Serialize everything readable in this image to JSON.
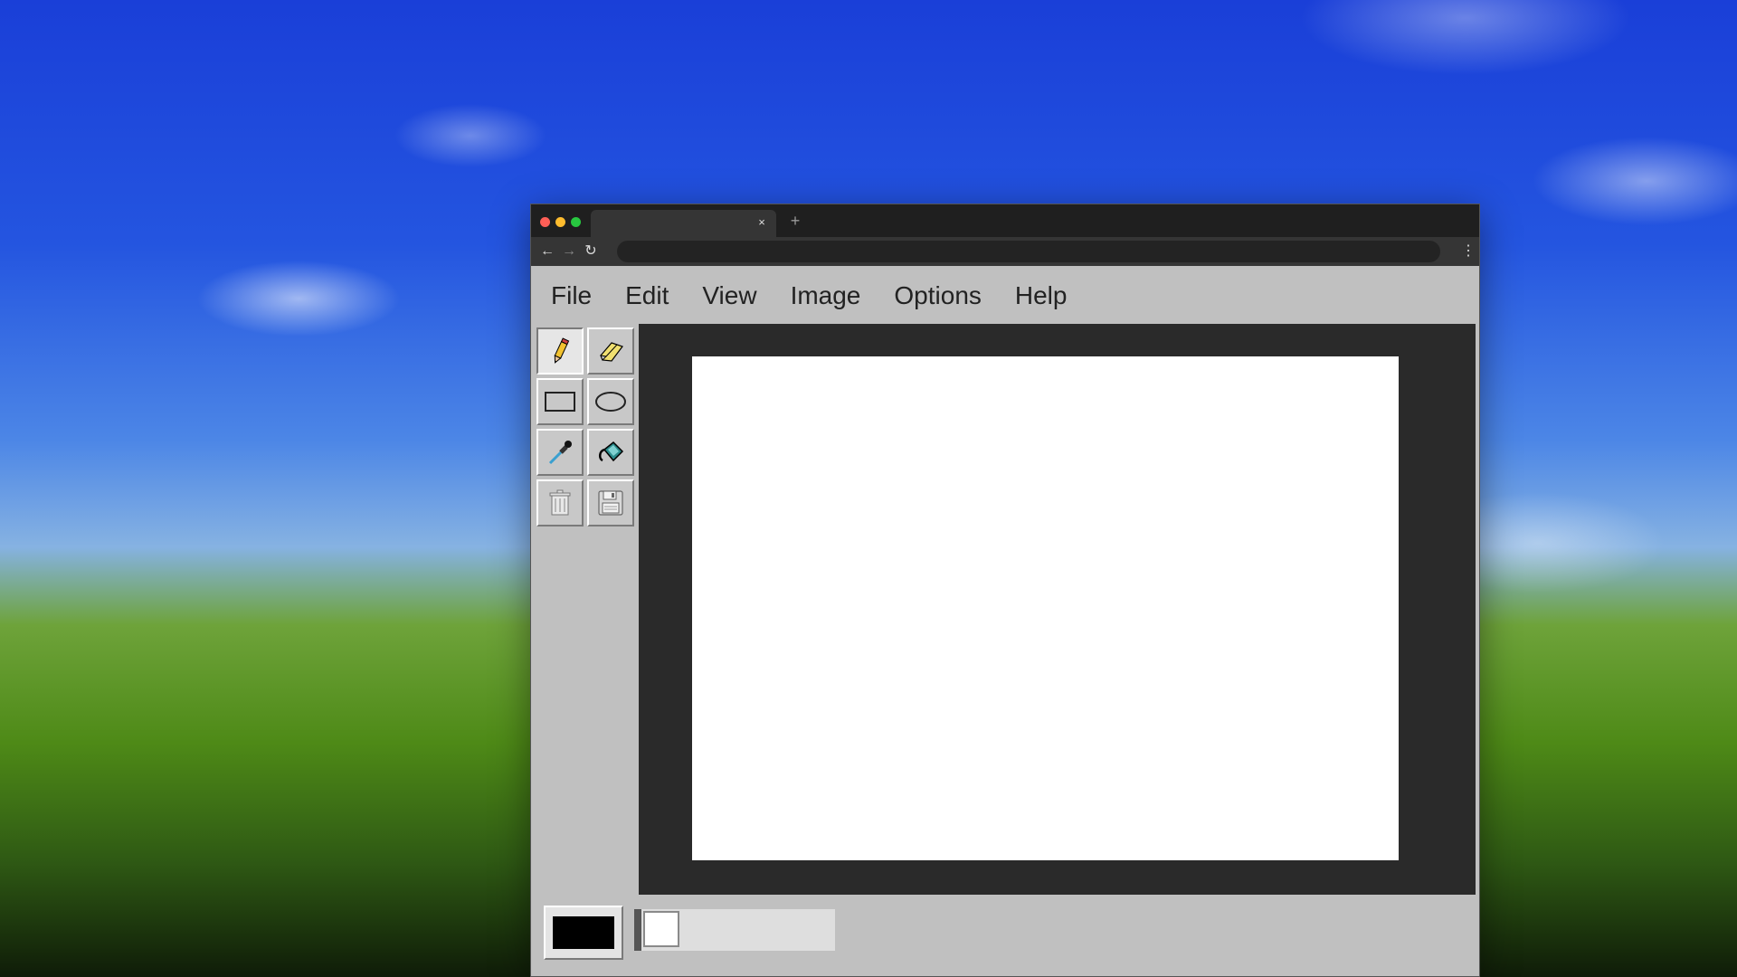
{
  "browser": {
    "tab_close": "×",
    "new_tab": "+",
    "back": "←",
    "forward": "→",
    "reload": "↻",
    "menu": "⋮"
  },
  "menu": {
    "items": [
      "File",
      "Edit",
      "View",
      "Image",
      "Options",
      "Help"
    ]
  },
  "tools": [
    {
      "name": "pencil-icon",
      "active": true
    },
    {
      "name": "eraser-icon",
      "active": false
    },
    {
      "name": "rectangle-icon",
      "active": false
    },
    {
      "name": "ellipse-icon",
      "active": false
    },
    {
      "name": "eyedropper-icon",
      "active": false
    },
    {
      "name": "paint-bucket-icon",
      "active": false
    },
    {
      "name": "trash-icon",
      "active": false
    },
    {
      "name": "save-icon",
      "active": false
    }
  ],
  "colors": {
    "primary": "#000000",
    "palette": [
      "#ffffff"
    ]
  }
}
